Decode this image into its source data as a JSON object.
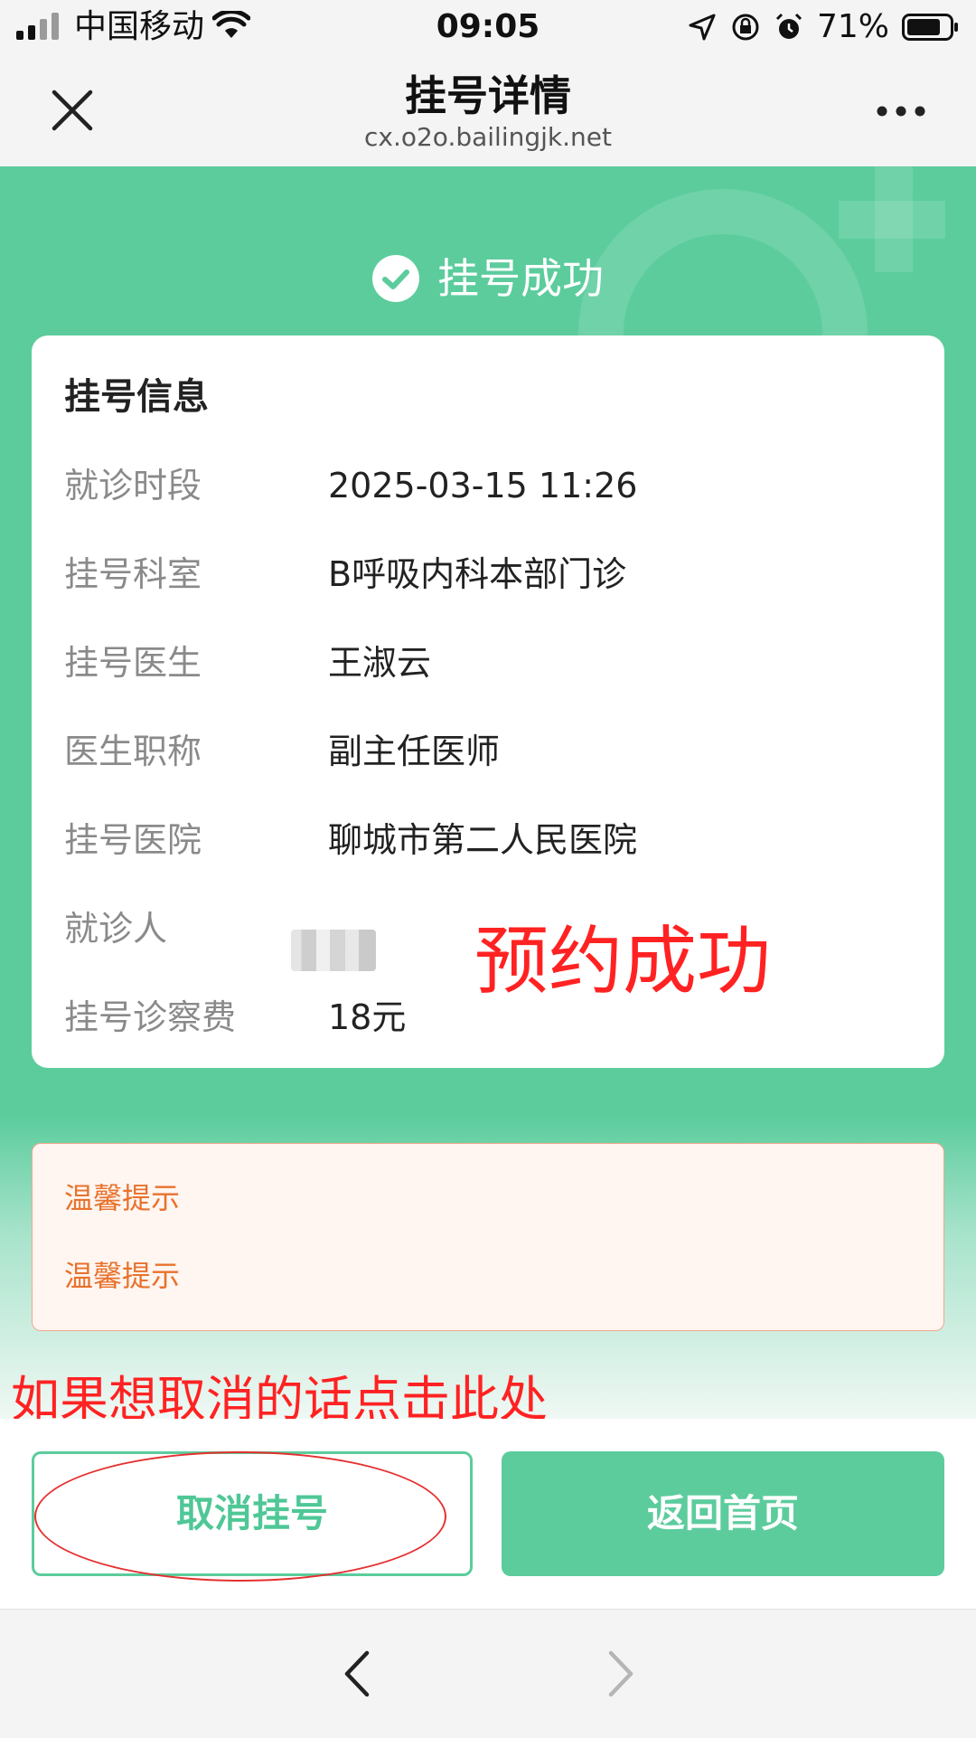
{
  "status_bar": {
    "carrier": "中国移动",
    "time": "09:05",
    "battery": "71%",
    "icons": [
      "signal-icon",
      "wifi-icon",
      "location-icon",
      "rotation-lock-icon",
      "alarm-icon",
      "battery-icon"
    ]
  },
  "nav": {
    "title": "挂号详情",
    "url": "cx.o2o.bailingjk.net",
    "close_icon": "close-icon",
    "more_icon": "more-icon"
  },
  "banner": {
    "success_text": "挂号成功",
    "icon": "check-circle-icon"
  },
  "info_card": {
    "title": "挂号信息",
    "rows": [
      {
        "label": "就诊时段",
        "value": "2025-03-15 11:26"
      },
      {
        "label": "挂号科室",
        "value": "B呼吸内科本部门诊"
      },
      {
        "label": "挂号医生",
        "value": "王淑云"
      },
      {
        "label": "医生职称",
        "value": "副主任医师"
      },
      {
        "label": "挂号医院",
        "value": "聊城市第二人民医院"
      },
      {
        "label": "就诊人",
        "value": ""
      },
      {
        "label": "挂号诊察费",
        "value": "18元"
      }
    ]
  },
  "annotations": {
    "success": "预约成功",
    "cancel_hint": "如果想取消的话点击此处",
    "color": "#ff2222"
  },
  "tips": {
    "line1": "温馨提示",
    "line2": "温馨提示"
  },
  "buttons": {
    "cancel": "取消挂号",
    "home": "返回首页"
  },
  "colors": {
    "brand_green": "#5ccc9d",
    "tip_orange": "#e8722c",
    "tip_background": "#fff5f1"
  }
}
